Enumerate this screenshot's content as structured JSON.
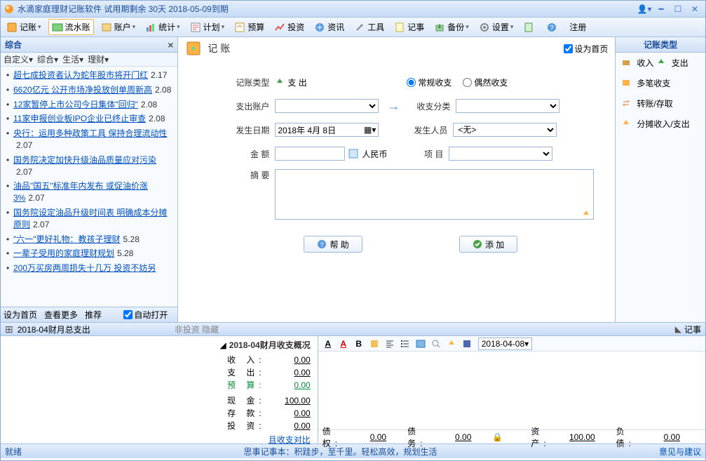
{
  "titlebar": {
    "title": "水滴家庭理财记账软件 试用期剩余 30天 2018-05-09到期"
  },
  "toolbar": {
    "items": [
      {
        "label": "记账"
      },
      {
        "label": "流水账"
      },
      {
        "label": "账户"
      },
      {
        "label": "统计"
      },
      {
        "label": "计划"
      },
      {
        "label": "预算"
      },
      {
        "label": "投资"
      },
      {
        "label": "资讯"
      },
      {
        "label": "工具"
      },
      {
        "label": "记事"
      },
      {
        "label": "备份"
      },
      {
        "label": "设置"
      },
      {
        "label": "注册"
      }
    ]
  },
  "leftpanel": {
    "title": "综合",
    "tabs": [
      "自定义",
      "综合",
      "生活",
      "理财"
    ],
    "news": [
      {
        "t": "超七成投资者认为蛇年股市将开门红",
        "n": "2.17"
      },
      {
        "t": "6620亿元  公开市场净投放创单周新高",
        "n": "2.08"
      },
      {
        "t": "12家暂停上市公司今日集体\"回归\"",
        "n": "2.08"
      },
      {
        "t": "11家申报创业板IPO企业已终止审查",
        "n": "2.08"
      },
      {
        "t": "央行：运用多种政策工具  保持合理流动性",
        "n": "2.07"
      },
      {
        "t": "国务院决定加快升级油品质量应对污染",
        "n": "2.07"
      },
      {
        "t": "油品\"国五\"标准年内发布  或促油价涨3%",
        "n": "2.07"
      },
      {
        "t": "国务院设定油品升级时间表  明确成本分摊原则",
        "n": "2.07"
      },
      {
        "t": "\"六一\"更好礼物：教孩子理财",
        "n": "5.28"
      },
      {
        "t": "一辈子受用的家庭理财规划",
        "n": "5.28"
      },
      {
        "t": "200万买房两周损失十几万  投资不妨另",
        "n": ""
      }
    ],
    "footer": {
      "a": "设为首页",
      "b": "查看更多",
      "c": "推荐",
      "chk": "自动打开"
    }
  },
  "center": {
    "title": "记 账",
    "sethome": "设为首页",
    "labels": {
      "type": "记账类型",
      "typeval": "支 出",
      "acct": "支出账户",
      "cat": "收支分类",
      "regular": "常规收支",
      "occasional": "偶然收支",
      "date": "发生日期",
      "dateval": "2018年 4月 8日",
      "person": "发生人员",
      "personval": "<无>",
      "amount": "金   额",
      "unit": "人民币",
      "project": "项   目",
      "memo": "摘   要",
      "help": "帮 助",
      "add": "添 加"
    }
  },
  "rightpanel": {
    "title": "记账类型",
    "items": [
      {
        "a": "收入",
        "b": "支出"
      },
      {
        "a": "多笔收支"
      },
      {
        "a": "转账/存取"
      },
      {
        "a": "分摊收入/支出"
      }
    ]
  },
  "bottombar": {
    "left": "2018-04财月总支出",
    "mid": "非投资 隐藏",
    "right": "记事"
  },
  "summary": {
    "title": "2018-04财月收支概况",
    "rows": [
      {
        "l": "收 入:",
        "v": "0.00"
      },
      {
        "l": "支 出:",
        "v": "0.00"
      },
      {
        "l": "预 算:",
        "v": "0.00",
        "green": true
      }
    ],
    "rows2": [
      {
        "l": "现 金:",
        "v": "100.00"
      },
      {
        "l": "存 款:",
        "v": "0.00"
      },
      {
        "l": "投 资:",
        "v": "0.00"
      }
    ],
    "link": "且收支对比"
  },
  "editor": {
    "date": "2018-04-08",
    "status": [
      {
        "l": "债 权:",
        "v": "0.00"
      },
      {
        "l": "债 务:",
        "v": "0.00"
      },
      {
        "l": "资 产:",
        "v": "100.00"
      },
      {
        "l": "负 债:",
        "v": "0.00"
      }
    ]
  },
  "footer": {
    "left": "就绪",
    "mid": "思事记事本：积跬步，至千里。轻松高效，规划生活",
    "right": "意见与建议"
  }
}
